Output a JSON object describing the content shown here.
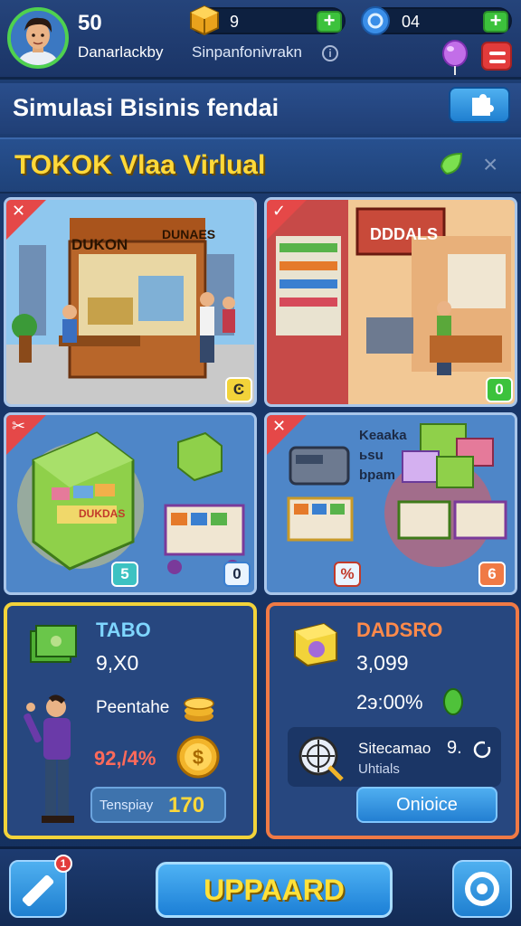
{
  "player": {
    "level": "50",
    "name": "Danarlackby",
    "status": "Sinpanfonivrakn",
    "info": "i"
  },
  "currencies": {
    "coins": "9",
    "gems": "04",
    "plus": "+"
  },
  "header": {
    "title": "Simulasi Bisinis fendai"
  },
  "shop": {
    "title": "TOKOK Vlaa Virlual",
    "close": "×"
  },
  "cards": [
    {
      "sign": "DUKON",
      "sign2": "DUNAES",
      "corner": "✕",
      "badge": "Ͼ",
      "badge_color": "#f2d33a"
    },
    {
      "sign": "DDDALS",
      "corner": "✓",
      "badge": "0",
      "badge_color": "#3cc23c"
    },
    {
      "corner": "✂",
      "badge": "5",
      "badge_color": "#3cc2c2",
      "sign": "DUKDAS"
    },
    {
      "corner": "✕",
      "badge": "6",
      "badge_color": "#f07a45",
      "badge_left": "%",
      "label_lines": [
        "Keaaka",
        "ьsu",
        "bpam"
      ]
    }
  ],
  "panel_left": {
    "name": "TABO",
    "value": "9,X0",
    "sublabel": "Peentahe",
    "rate": "92,/4%",
    "chip_label": "Tenspiay",
    "chip_value": "170"
  },
  "panel_right": {
    "name": "DADSRO",
    "value": "3,099",
    "income": "2э:00%",
    "stat_line1": "Sitecamao",
    "stat_line2": "Uhtials",
    "stat_value": "9.",
    "action": "Onioice"
  },
  "bottom": {
    "badge": "1",
    "upgrade": "UPPAARD"
  },
  "colors": {
    "accent_yellow": "#ffd93a",
    "accent_green": "#3cc23c",
    "accent_red": "#e23b3b",
    "accent_blue": "#2a8ae0"
  }
}
